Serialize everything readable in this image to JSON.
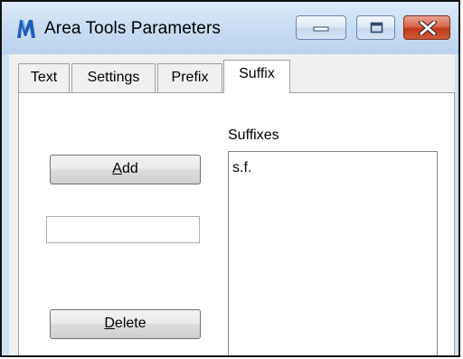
{
  "window": {
    "title": "Area Tools Parameters",
    "icon": "area-tools-app-icon",
    "controls": {
      "minimize": "minimize-icon",
      "maximize": "maximize-icon",
      "close": "close-icon"
    }
  },
  "tabs": [
    {
      "label": "Text",
      "active": false
    },
    {
      "label": "Settings",
      "active": false
    },
    {
      "label": "Prefix",
      "active": false
    },
    {
      "label": "Suffix",
      "active": true
    }
  ],
  "suffix_tab": {
    "add_button": {
      "pre": "",
      "mnemonic": "A",
      "post": "dd"
    },
    "delete_button": {
      "pre": "",
      "mnemonic": "D",
      "post": "elete"
    },
    "new_suffix_input": {
      "value": ""
    },
    "list_label": "Suffixes",
    "items": [
      "s.f."
    ]
  },
  "colors": {
    "close_button": "#c2391b",
    "titlebar": "#c9dcf1"
  }
}
